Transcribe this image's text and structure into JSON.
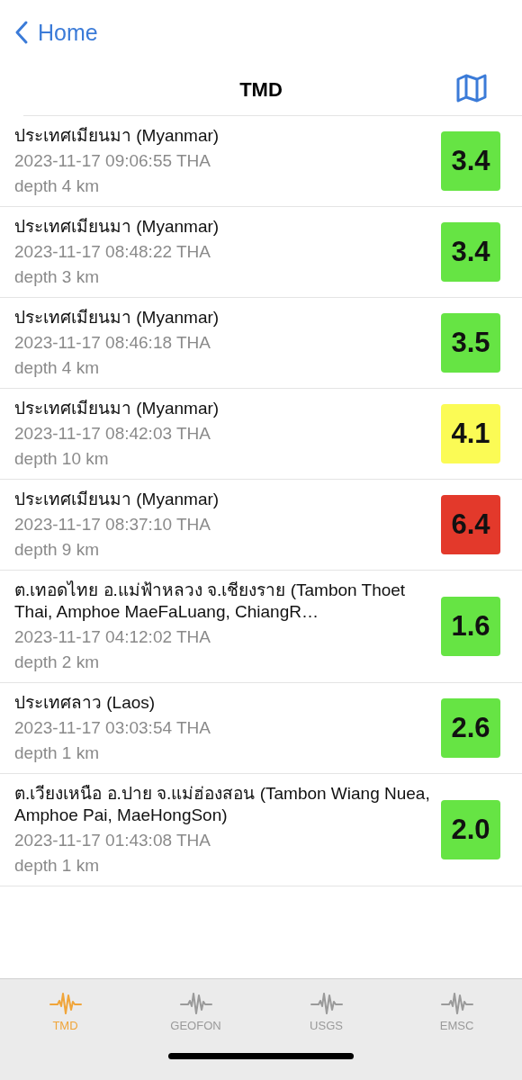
{
  "nav": {
    "back_label": "Home",
    "title": "TMD"
  },
  "quakes": [
    {
      "place": "ประเทศเมียนมา (Myanmar)",
      "time": "2023-11-17 09:06:55 THA",
      "depth": "depth 4 km",
      "magnitude": "3.4",
      "color": "#66e444"
    },
    {
      "place": "ประเทศเมียนมา (Myanmar)",
      "time": "2023-11-17 08:48:22 THA",
      "depth": "depth 3 km",
      "magnitude": "3.4",
      "color": "#66e444"
    },
    {
      "place": "ประเทศเมียนมา (Myanmar)",
      "time": "2023-11-17 08:46:18 THA",
      "depth": "depth 4 km",
      "magnitude": "3.5",
      "color": "#66e444"
    },
    {
      "place": "ประเทศเมียนมา (Myanmar)",
      "time": "2023-11-17 08:42:03 THA",
      "depth": "depth 10 km",
      "magnitude": "4.1",
      "color": "#fbfb55"
    },
    {
      "place": "ประเทศเมียนมา (Myanmar)",
      "time": "2023-11-17 08:37:10 THA",
      "depth": "depth 9 km",
      "magnitude": "6.4",
      "color": "#e3392b"
    },
    {
      "place": "ต.เทอดไทย อ.แม่ฟ้าหลวง จ.เชียงราย (Tambon Thoet Thai, Amphoe MaeFaLuang, ChiangR…",
      "time": "2023-11-17 04:12:02 THA",
      "depth": "depth 2 km",
      "magnitude": "1.6",
      "color": "#66e444"
    },
    {
      "place": "ประเทศลาว (Laos)",
      "time": "2023-11-17 03:03:54 THA",
      "depth": "depth 1 km",
      "magnitude": "2.6",
      "color": "#66e444"
    },
    {
      "place": "ต.เวียงเหนือ อ.ปาย จ.แม่ฮ่องสอน (Tambon Wiang Nuea, Amphoe Pai, MaeHongSon)",
      "time": "2023-11-17 01:43:08 THA",
      "depth": "depth 1 km",
      "magnitude": "2.0",
      "color": "#66e444"
    }
  ],
  "tabs": [
    {
      "label": "TMD",
      "selected": true
    },
    {
      "label": "GEOFON",
      "selected": false
    },
    {
      "label": "USGS",
      "selected": false
    },
    {
      "label": "EMSC",
      "selected": false
    }
  ]
}
